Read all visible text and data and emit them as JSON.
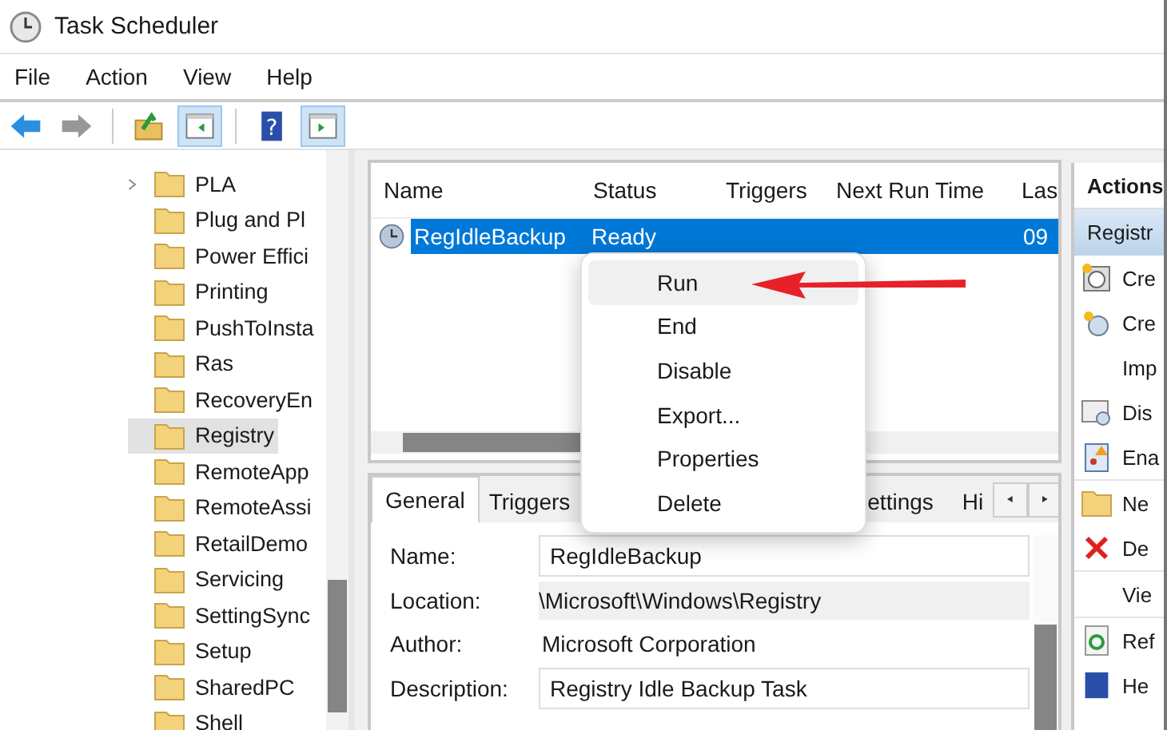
{
  "window": {
    "title": "Task Scheduler"
  },
  "menu": [
    "File",
    "Action",
    "View",
    "Help"
  ],
  "toolbar": [
    {
      "kind": "back",
      "disabled": false,
      "pressed": false
    },
    {
      "kind": "forward",
      "disabled": true,
      "pressed": false
    },
    {
      "kind": "up",
      "disabled": false,
      "pressed": false
    },
    {
      "kind": "tree-toggle",
      "disabled": false,
      "pressed": true
    },
    {
      "kind": "help",
      "disabled": false,
      "pressed": false,
      "glyph": "?"
    },
    {
      "kind": "pane-toggle",
      "disabled": false,
      "pressed": true
    }
  ],
  "tree": {
    "items": [
      {
        "label": "PLA",
        "expandable": true,
        "selected": false
      },
      {
        "label": "Plug and Pl",
        "expandable": false,
        "selected": false
      },
      {
        "label": "Power Effici",
        "expandable": false,
        "selected": false
      },
      {
        "label": "Printing",
        "expandable": false,
        "selected": false
      },
      {
        "label": "PushToInsta",
        "expandable": false,
        "selected": false
      },
      {
        "label": "Ras",
        "expandable": false,
        "selected": false
      },
      {
        "label": "RecoveryEn",
        "expandable": false,
        "selected": false
      },
      {
        "label": "Registry",
        "expandable": false,
        "selected": true
      },
      {
        "label": "RemoteApp",
        "expandable": false,
        "selected": false
      },
      {
        "label": "RemoteAssi",
        "expandable": false,
        "selected": false
      },
      {
        "label": "RetailDemo",
        "expandable": false,
        "selected": false
      },
      {
        "label": "Servicing",
        "expandable": false,
        "selected": false
      },
      {
        "label": "SettingSync",
        "expandable": false,
        "selected": false
      },
      {
        "label": "Setup",
        "expandable": false,
        "selected": false
      },
      {
        "label": "SharedPC",
        "expandable": false,
        "selected": false
      },
      {
        "label": "Shell",
        "expandable": false,
        "selected": false
      }
    ]
  },
  "task_list": {
    "columns": [
      "Name",
      "Status",
      "Triggers",
      "Next Run Time",
      "Las"
    ],
    "rows": [
      {
        "cells": [
          "RegIdleBackup",
          "Ready",
          "",
          "",
          "09"
        ],
        "selected": true
      }
    ]
  },
  "context_menu": {
    "items": [
      {
        "label": "Run",
        "hovered": true
      },
      {
        "label": "End",
        "hovered": false
      },
      {
        "label": "Disable",
        "hovered": false
      },
      {
        "label": "Export...",
        "hovered": false
      },
      {
        "label": "Properties",
        "hovered": false
      },
      {
        "label": "Delete",
        "hovered": false
      }
    ]
  },
  "details": {
    "tabs": [
      {
        "label": "General",
        "selected": true
      },
      {
        "label": "Triggers",
        "selected": false
      },
      {
        "label": "ettings",
        "selected": false
      },
      {
        "label": "Hi",
        "selected": false
      }
    ],
    "fields": [
      {
        "label": "Name:",
        "value": "RegIdleBackup",
        "kind": "box"
      },
      {
        "label": "Location:",
        "value": "\\Microsoft\\Windows\\Registry",
        "kind": "shaded"
      },
      {
        "label": "Author:",
        "value": "Microsoft Corporation",
        "kind": "plain"
      },
      {
        "label": "Description:",
        "value": "Registry Idle Backup Task",
        "kind": "box"
      }
    ]
  },
  "actions": {
    "title": "Actions",
    "section": "Registr",
    "items": [
      {
        "label": "Cre"
      },
      {
        "label": "Cre"
      },
      {
        "label": "Imp"
      },
      {
        "label": "Dis"
      },
      {
        "label": "Ena"
      },
      {
        "label": "Ne"
      },
      {
        "label": "De"
      },
      {
        "label": "Vie"
      },
      {
        "label": "Ref"
      },
      {
        "label": "He"
      }
    ]
  }
}
